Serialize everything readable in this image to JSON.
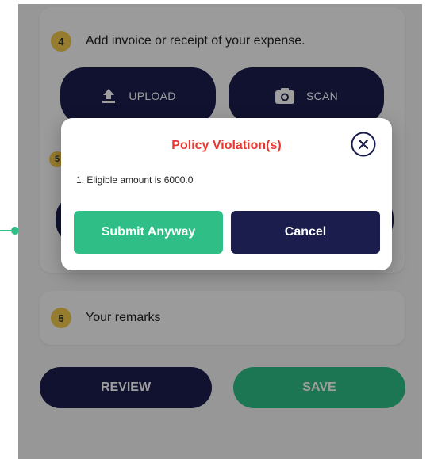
{
  "step4": {
    "number": "4",
    "title": "Add invoice or receipt of your expense.",
    "upload_label": "UPLOAD",
    "scan_label": "SCAN",
    "hidden_step_number": "5"
  },
  "step5": {
    "number": "5",
    "title": "Your remarks"
  },
  "footer": {
    "review_label": "REVIEW",
    "save_label": "SAVE"
  },
  "modal": {
    "title": "Policy Violation(s)",
    "message": "1. Eligible amount is 6000.0",
    "submit_label": "Submit Anyway",
    "cancel_label": "Cancel"
  },
  "colors": {
    "navy": "#1b1d4d",
    "green": "#2fbf86",
    "error_red": "#e8372f",
    "badge_yellow": "#f2c84b"
  },
  "icons": [
    "upload-icon",
    "camera-icon",
    "close-circle-icon"
  ]
}
